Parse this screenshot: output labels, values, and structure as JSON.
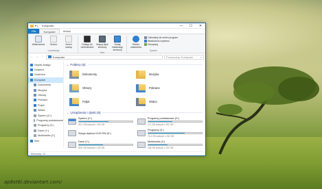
{
  "window": {
    "title": "Komputer",
    "quick_access": "▾ |",
    "controls": {
      "minimize": "—",
      "maximize": "☐",
      "close": "✕"
    }
  },
  "tabs": [
    "Plik",
    "Komputer",
    "Widok"
  ],
  "ribbon": {
    "groups": [
      {
        "name": "Lokalizacja",
        "buttons": [
          "Właściwości",
          "Otwórz",
          "Zmień nazwę"
        ]
      },
      {
        "name": "Sieć",
        "buttons": [
          "Dostęp do multimediów",
          "Mapuj dysk sieciowy",
          "Dodaj lokalizację sieciową"
        ]
      },
      {
        "name": "",
        "buttons": [
          "Otwórz ustawienia"
        ]
      }
    ],
    "system_items": [
      "Odinstaluj lub zmień program",
      "Właściwości systemu",
      "Zarządzaj"
    ],
    "system_group_name": "System"
  },
  "address": {
    "back": "←",
    "forward": "→",
    "up": "↑",
    "path": "Komputer",
    "search_placeholder": "Przeszukaj: Komputer",
    "search_icon": "⌕"
  },
  "nav_pane": [
    {
      "label": "Szybki dostęp",
      "color": "#2f7fd1"
    },
    {
      "label": "Dropbox",
      "color": "#2f7fd1"
    },
    {
      "label": "OneDrive",
      "color": "#2f7fd1"
    },
    {
      "label": "Komputer",
      "color": "#3a7fc1",
      "selected": true
    },
    {
      "label": "Dokumenty",
      "color": "#6e8fb4"
    },
    {
      "label": "Muzyka",
      "color": "#6e8fb4"
    },
    {
      "label": "Obrazy",
      "color": "#6e8fb4"
    },
    {
      "label": "Pobrane",
      "color": "#2f7fd1"
    },
    {
      "label": "Pulpit",
      "color": "#2f7fd1"
    },
    {
      "label": "Wideo",
      "color": "#6e8fb4"
    },
    {
      "label": "System (C:)",
      "color": "#9aa3ad"
    },
    {
      "label": "Programy podstawowe",
      "color": "#9aa3ad"
    },
    {
      "label": "Programy (X:)",
      "color": "#9aa3ad"
    },
    {
      "label": "Dane (Y:)",
      "color": "#9aa3ad"
    },
    {
      "label": "Multimedia (Z:)",
      "color": "#9aa3ad"
    },
    {
      "label": "Sieć",
      "color": "#2f7fd1"
    }
  ],
  "folders_section": {
    "title": "Foldery (6)"
  },
  "folders": [
    "Dokumenty",
    "Muzyka",
    "Obrazy",
    "Pobrane",
    "Pulpit",
    "Wideo"
  ],
  "drives_section": {
    "title": "Urządzenia i dyski (6)"
  },
  "drives": [
    {
      "name": "System (C:)",
      "free": "45,1 GB wolnych z 100 GB",
      "used": 0.55
    },
    {
      "name": "Programy podstawowe (D:)",
      "free": "127 GB wolnych z 232 GB",
      "used": 0.45
    },
    {
      "name": "Stacja dysków DVD RW (E:)",
      "free": "",
      "used": 0
    },
    {
      "name": "Programy (X:)",
      "free": "73,4 GB wolnych z 232 GB",
      "used": 0.68
    },
    {
      "name": "Dane (Y:)",
      "free": "55,5 GB wolnych z 100 GB",
      "used": 0.45
    },
    {
      "name": "Multimedia (Z:)",
      "free": "148 GB wolnych z 232 GB",
      "used": 0.36
    }
  ],
  "status": {
    "items": "Elementy: 12"
  },
  "watermark": "ap8st6l.deviantart.com/"
}
